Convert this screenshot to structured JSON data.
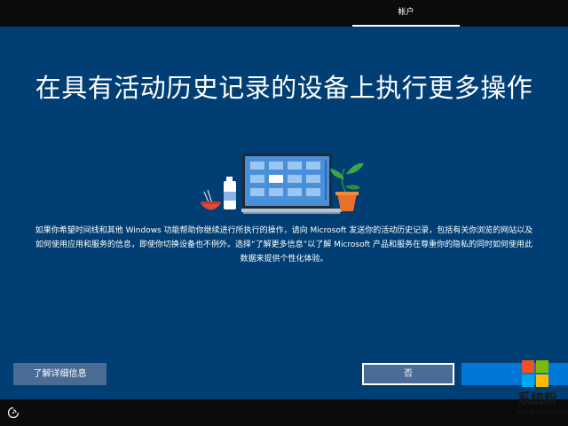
{
  "header": {
    "active_step": "帐户"
  },
  "main": {
    "title": "在具有活动历史记录的设备上执行更多操作",
    "description_lines": [
      "如果你希望时间线和其他 Windows 功能帮助你继续进行所执行的操作，请向 Microsoft 发送你的活动历史记录，包括有关你浏览的网站以及",
      "如何使用应用和服务的信息，即使你切换设备也不例外。选择“了解更多信息”以了解 Microsoft 产品和服务在尊重你的隐私的同时如何使用此",
      "数据来提供个性化体验。"
    ],
    "illustration_icon": "laptop-plant-bottle-bowl-illustration"
  },
  "buttons": {
    "learn_more": "了解详细信息",
    "no": "否",
    "yes": ""
  },
  "footer": {
    "ease_of_access_icon": "ease-of-access-icon"
  },
  "watermark": {
    "text": "系统粉",
    "url": "www.win7999.com"
  },
  "colors": {
    "background": "#003e73",
    "button": "#4a6b93",
    "accent": "#0078d7",
    "bar": "#0b0b0b"
  }
}
